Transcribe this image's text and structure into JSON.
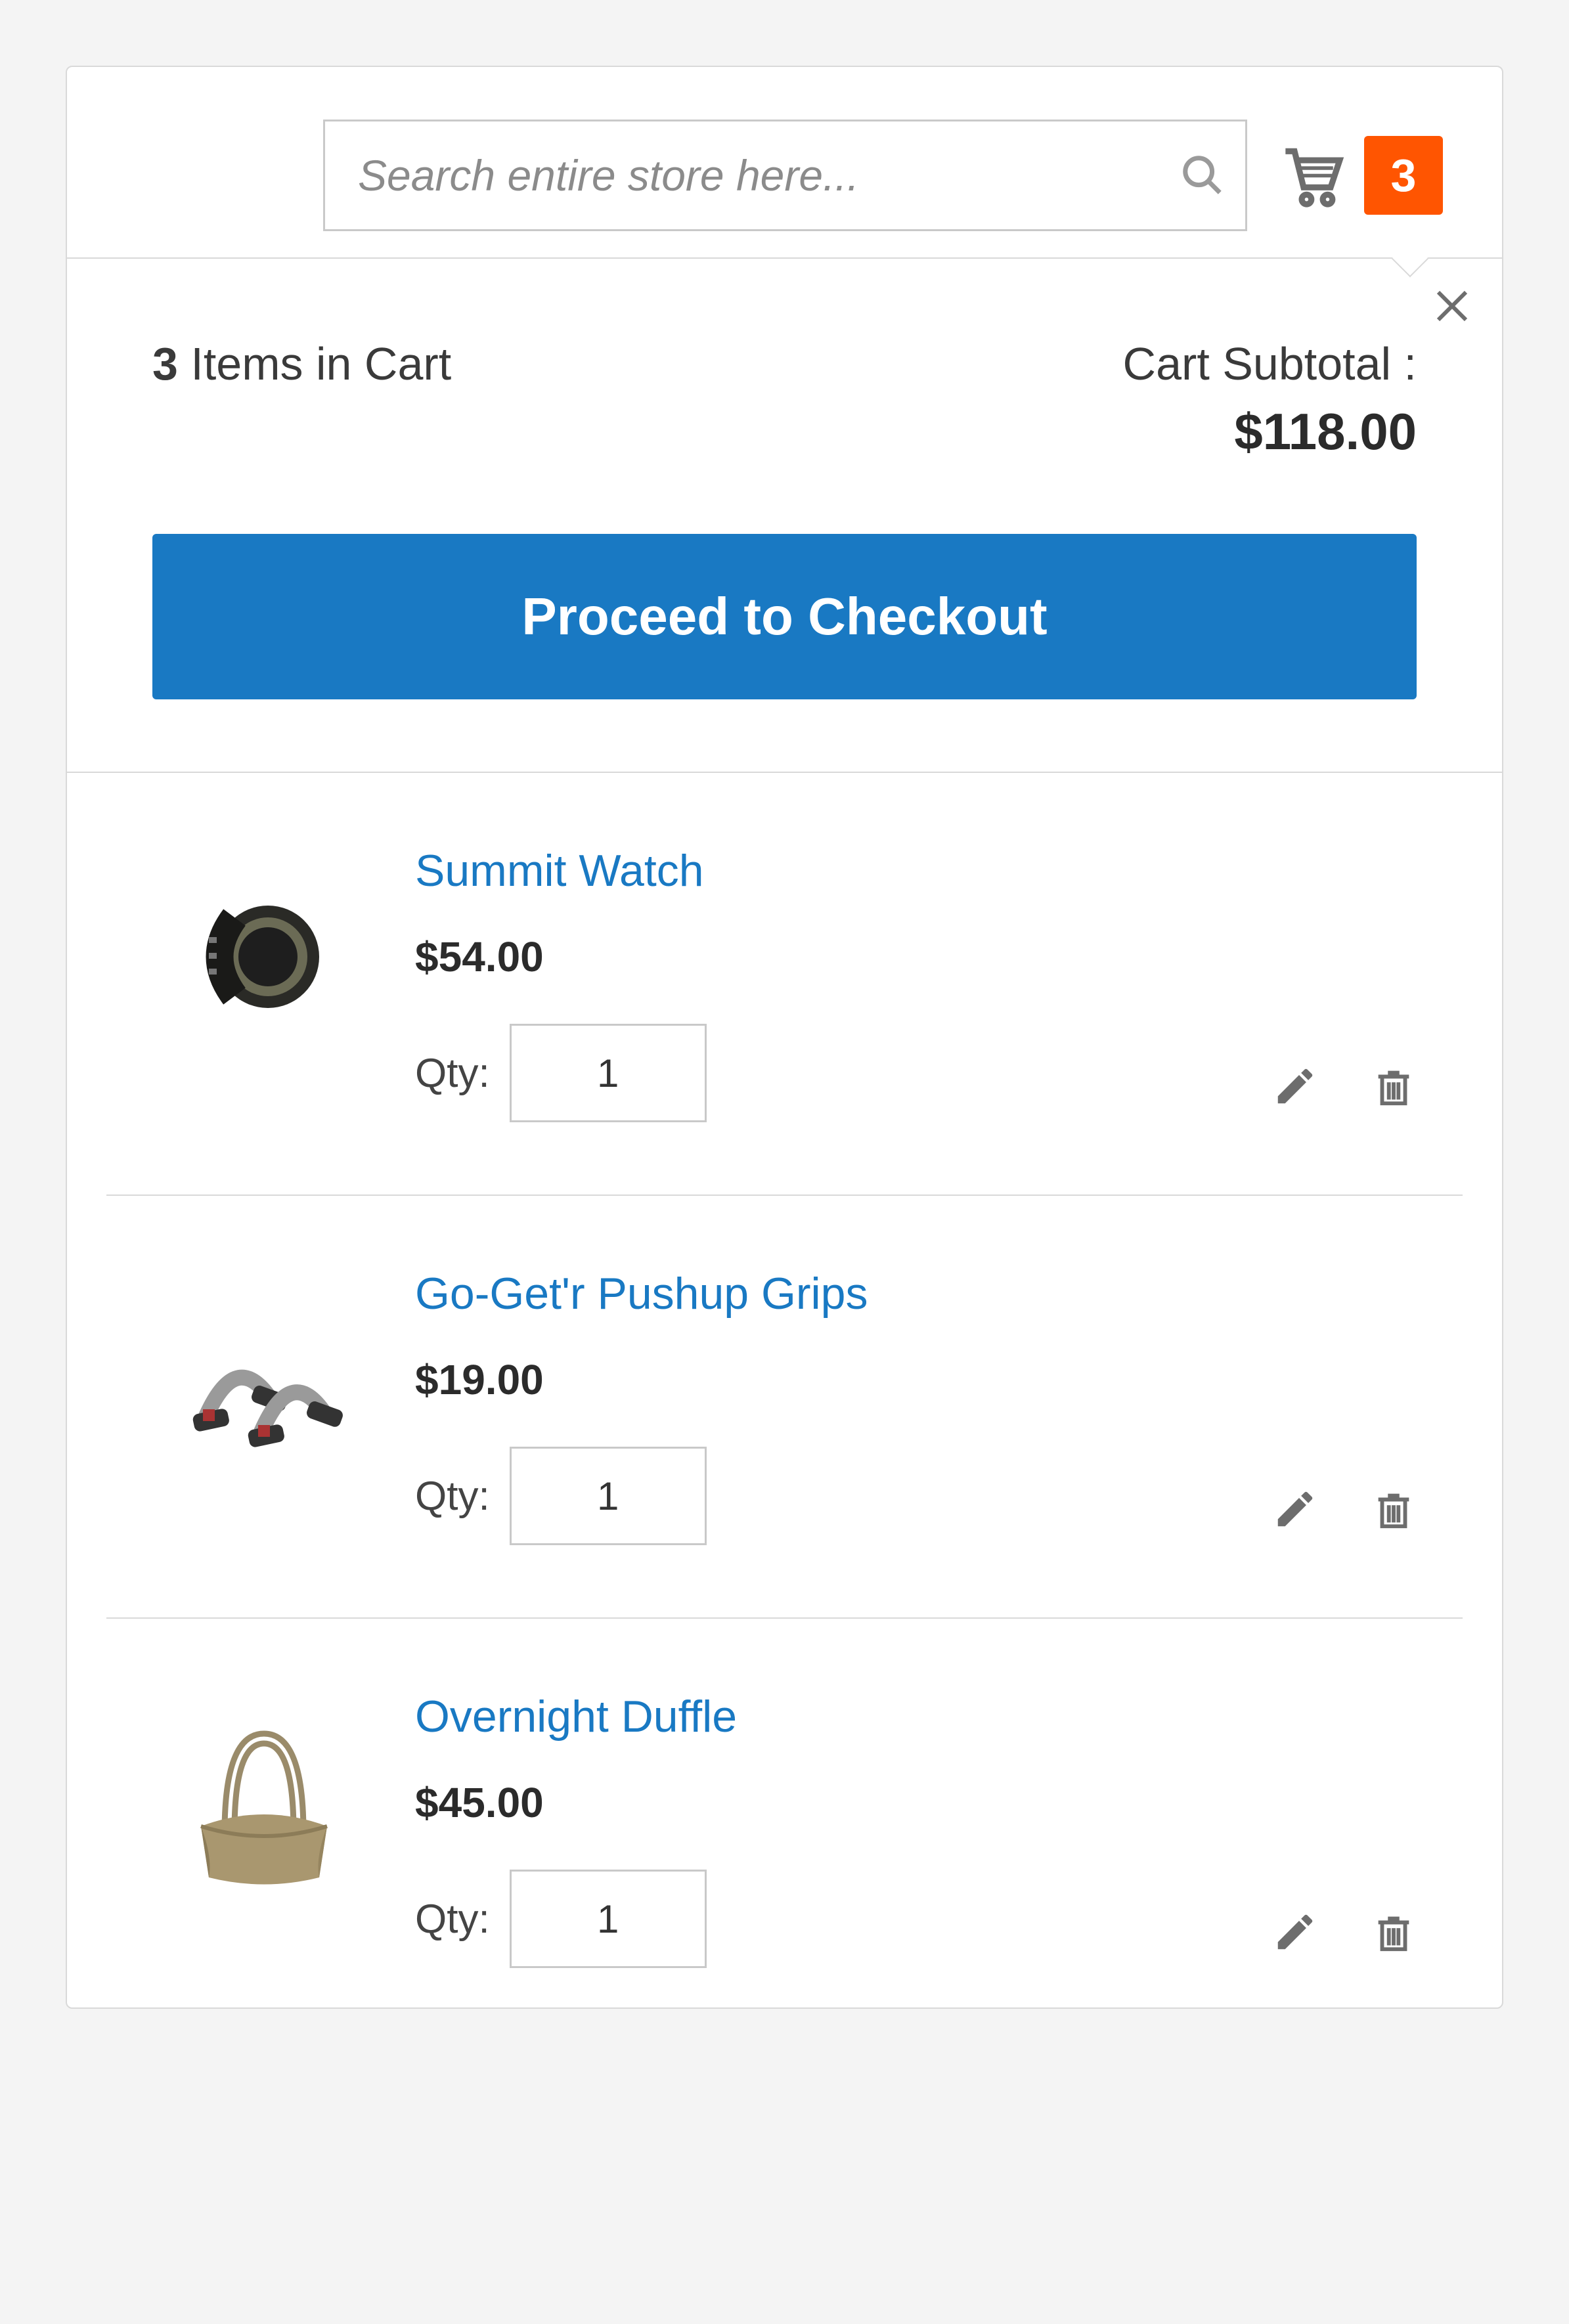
{
  "search": {
    "placeholder": "Search entire store here..."
  },
  "cart": {
    "badge_count": "3",
    "items_count": "3",
    "items_in_cart_suffix": " Items in Cart",
    "subtotal_label": "Cart Subtotal :",
    "subtotal_amount": "$118.00",
    "checkout_label": "Proceed to Checkout",
    "qty_label": "Qty:"
  },
  "items": [
    {
      "name": "Summit Watch",
      "price": "$54.00",
      "qty": "1"
    },
    {
      "name": "Go-Get'r Pushup Grips",
      "price": "$19.00",
      "qty": "1"
    },
    {
      "name": "Overnight Duffle",
      "price": "$45.00",
      "qty": "1"
    }
  ]
}
